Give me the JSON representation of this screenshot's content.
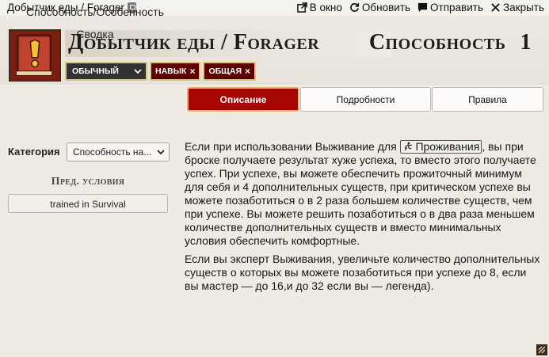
{
  "window": {
    "title": "Добытчик еды / Forager",
    "actions": [
      {
        "label": "В окно",
        "icon": "external-link-icon"
      },
      {
        "label": "Обновить",
        "icon": "refresh-icon"
      },
      {
        "label": "Отправить",
        "icon": "chat-icon"
      },
      {
        "label": "Закрыть",
        "icon": "close-icon"
      }
    ]
  },
  "header": {
    "name": "Добытчик еды / Forager",
    "type_label": "Способность",
    "level": "1",
    "rarity_select": "обычный",
    "tags": [
      "навык",
      "общая"
    ],
    "tag_remove_glyph": "×"
  },
  "sidebar": {
    "type_line": "Способность/Особенность",
    "summary_line": "Сводка",
    "category_label": "Категория",
    "category_value": "Способность на...",
    "prereq_title": "Пред. условия",
    "prereq_value": "trained in Survival"
  },
  "tabs": [
    {
      "label": "Описание",
      "active": true
    },
    {
      "label": "Подробности",
      "active": false
    },
    {
      "label": "Правила",
      "active": false
    }
  ],
  "content": {
    "p1_before": "Если при использовании Выживание для ",
    "p1_link": "Проживания",
    "p1_after": ", вы при броске получаете результат хуже успеха, то вместо этого получаете успех. При успехе, вы можете обеспечить прожиточный минимум для себя и 4 дополнительных существ, при критическом успехе вы можете позаботиться о в 2 раза большем количестве существ, чем при успехе. Вы можете решить позаботиться о в два раза меньшем количестве дополнительных существ и вместо минимальных условия обеспечить комфортные.",
    "p2": "Если вы эксперт Выживания, увеличьте количество дополнительных существ о которых вы можете позаботиться при успехе до 8, если вы мастер — до 16,и до 32 если вы — легенда)."
  }
}
